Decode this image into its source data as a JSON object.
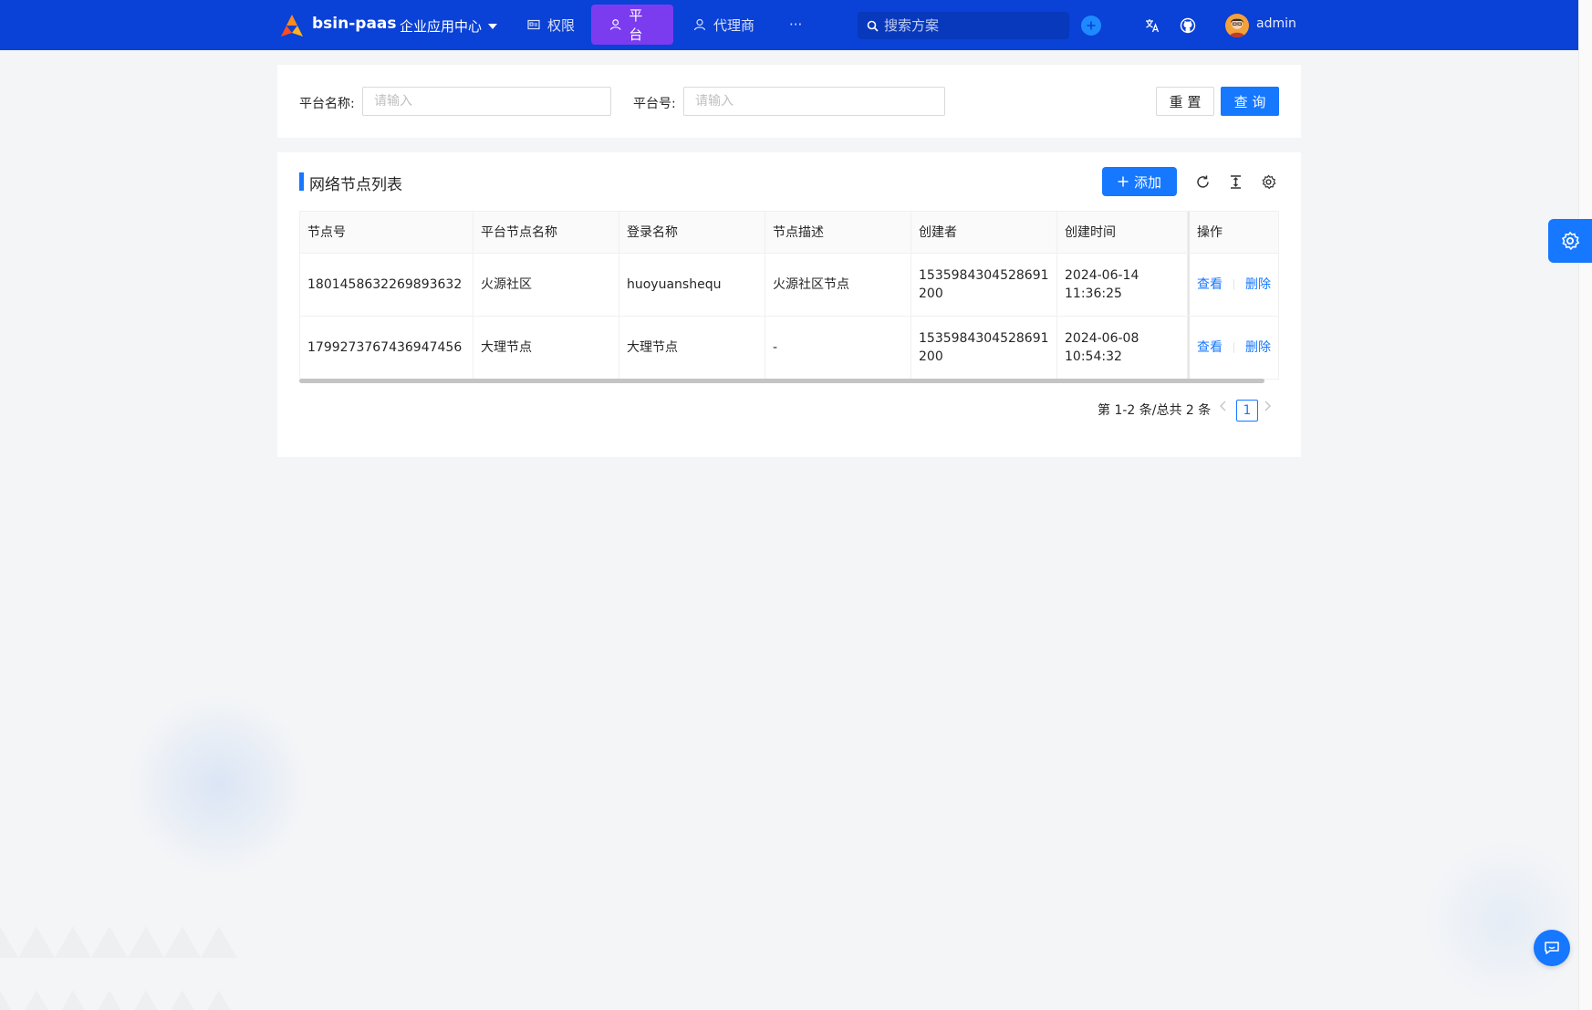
{
  "header": {
    "brand": "bsin-paas",
    "app_selector": "企业应用中心",
    "nav": [
      {
        "label": "权限",
        "icon": "id-card-icon",
        "active": false
      },
      {
        "label": "平台",
        "icon": "user-icon",
        "active": true
      },
      {
        "label": "代理商",
        "icon": "user-icon",
        "active": false
      },
      {
        "label": "···",
        "icon": "more-icon",
        "active": false
      }
    ],
    "search_placeholder": "搜索方案",
    "username": "admin",
    "colors": {
      "bar": "#0a41d6",
      "active_nav": "#7b3cf0"
    }
  },
  "filters": {
    "platform_name_label": "平台名称:",
    "platform_name_placeholder": "请输入",
    "platform_no_label": "平台号:",
    "platform_no_placeholder": "请输入",
    "reset_label": "重 置",
    "query_label": "查 询"
  },
  "table_card": {
    "title": "网络节点列表",
    "add_label": "添加",
    "columns": [
      "节点号",
      "平台节点名称",
      "登录名称",
      "节点描述",
      "创建者",
      "创建时间",
      "操作"
    ],
    "rows": [
      {
        "node_no": "1801458632269893632",
        "platform_node_name": "火源社区",
        "login_name": "huoyuanshequ",
        "description": "火源社区节点",
        "creator": "1535984304528691200",
        "created_at": "2024-06-14 11:36:25",
        "actions": [
          "查看",
          "删除"
        ]
      },
      {
        "node_no": "1799273767436947456",
        "platform_node_name": "大理节点",
        "login_name": "大理节点",
        "description": "-",
        "creator": "1535984304528691200",
        "created_at": "2024-06-08 10:54:32",
        "actions": [
          "查看",
          "删除"
        ]
      }
    ],
    "pagination": {
      "total_text": "第 1-2 条/总共 2 条",
      "current_page": "1"
    },
    "accent": "#1677ff"
  }
}
